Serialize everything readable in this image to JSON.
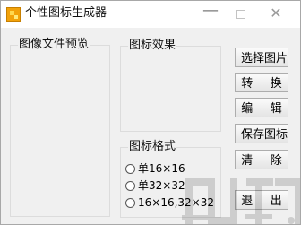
{
  "window": {
    "title": "个性图标生成器",
    "controls": {
      "minimize": "—",
      "close": "✕"
    }
  },
  "preview": {
    "label": "图像文件预览"
  },
  "effect": {
    "label": "图标效果"
  },
  "format": {
    "label": "图标格式",
    "options": [
      "单16×16",
      "单32×32",
      "16×16,32×32"
    ]
  },
  "buttons": {
    "select_image": "选择图片",
    "convert": "转 换",
    "edit": "编 辑",
    "save_icon": "保存图标",
    "clear": "清 除",
    "exit": "退 出"
  },
  "icons": {
    "app": "app-icon",
    "watermark": "watermark-logo"
  },
  "colors": {
    "window_background": "#f0f0f0",
    "title_background": "#ffffff",
    "accent_icon": "#f2a20a"
  }
}
